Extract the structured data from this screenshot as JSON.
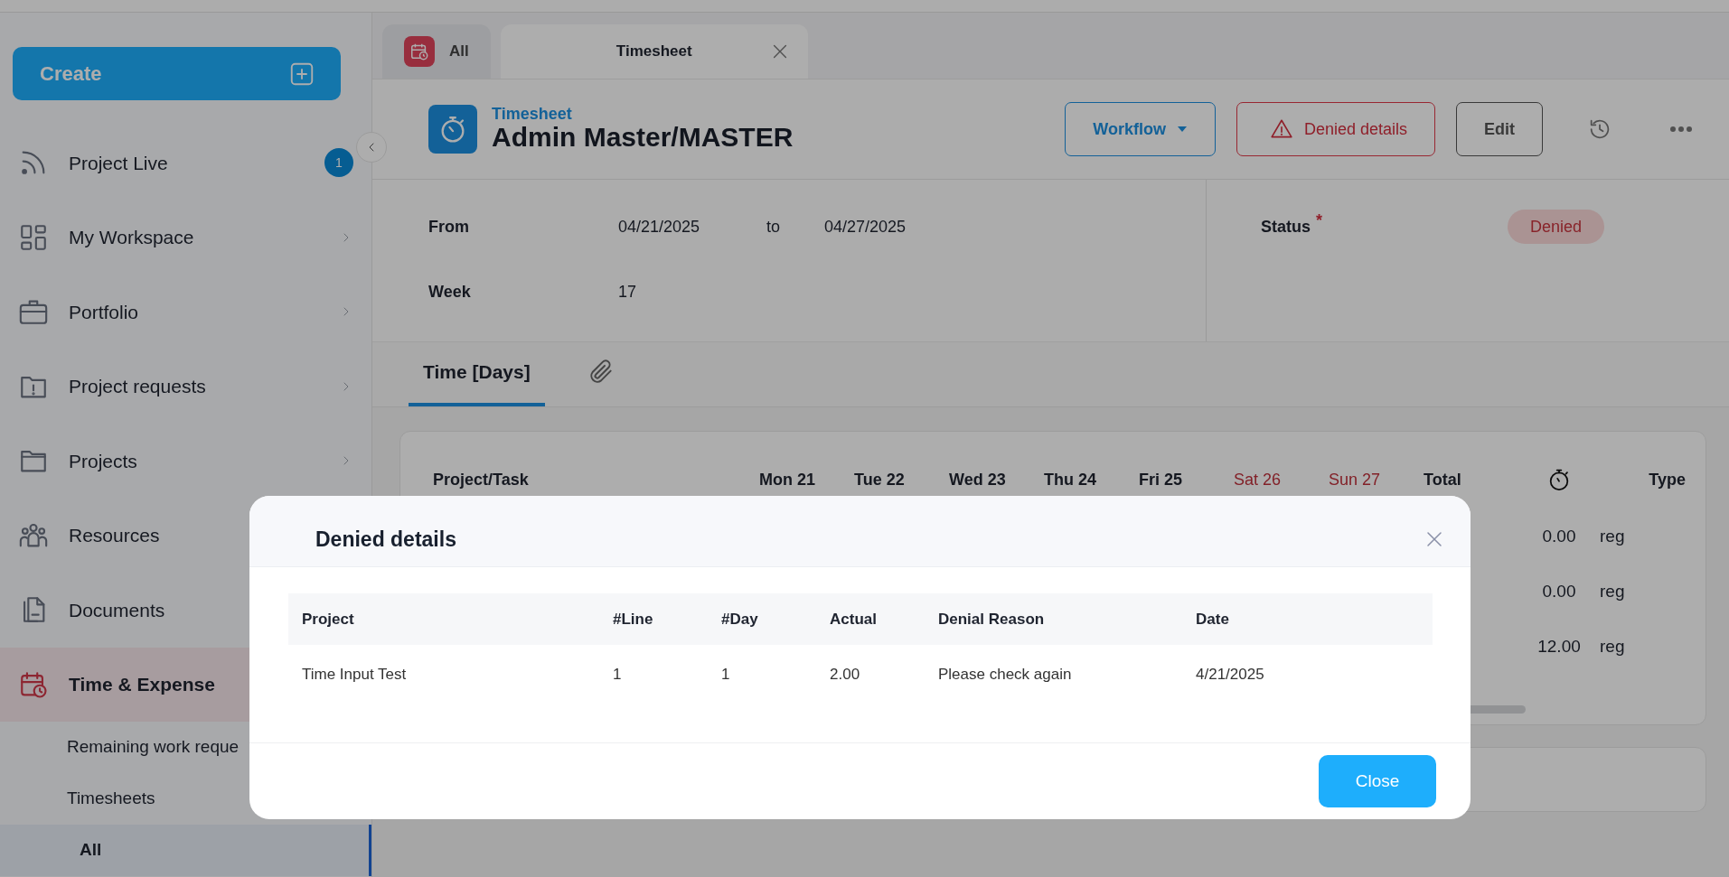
{
  "sidebar": {
    "create_button": {
      "label": "Create"
    },
    "items": [
      {
        "label": "Project Live",
        "badge": "1",
        "selected": false
      },
      {
        "label": "My Workspace",
        "has_submenu": true,
        "selected": false
      },
      {
        "label": "Portfolio",
        "has_submenu": true,
        "selected": false
      },
      {
        "label": "Project requests",
        "has_submenu": true,
        "selected": false
      },
      {
        "label": "Projects",
        "has_submenu": true,
        "selected": false
      },
      {
        "label": "Resources",
        "selected": false
      },
      {
        "label": "Documents",
        "selected": false
      },
      {
        "label": "Time & Expense",
        "selected": true,
        "children": [
          {
            "label": "Remaining work reque",
            "selected": false
          },
          {
            "label": "Timesheets",
            "selected": false,
            "children": [
              {
                "label": "All",
                "selected": true
              }
            ]
          }
        ]
      }
    ]
  },
  "tabs": [
    {
      "label": "All",
      "has_icon": true,
      "closable": false,
      "selected": false
    },
    {
      "label": "Timesheet",
      "has_icon": false,
      "closable": true,
      "selected": true
    }
  ],
  "header": {
    "subtitle": "Timesheet",
    "title": "Admin Master/MASTER",
    "buttons": [
      {
        "kind": "dropdown",
        "label": "Workflow"
      },
      {
        "kind": "danger",
        "label": "Denied details"
      },
      {
        "kind": "plain",
        "label": "Edit"
      }
    ]
  },
  "form": {
    "from_label": "From",
    "from": "04/21/2025",
    "to_label": "to",
    "to": "04/27/2025",
    "week_label": "Week",
    "week": "17",
    "status_label": "Status",
    "status_required_mark": "*",
    "status": "Denied"
  },
  "section_tabs": [
    {
      "kind": "text",
      "label": "Time [Days]",
      "selected": true
    },
    {
      "kind": "attachment",
      "selected": false
    }
  ],
  "timesheet_table": {
    "columns": [
      {
        "kind": "text",
        "label": "Project/Task",
        "weekend": false
      },
      {
        "kind": "text",
        "label": "Mon 21",
        "weekend": false
      },
      {
        "kind": "text",
        "label": "Tue 22",
        "weekend": false
      },
      {
        "kind": "text",
        "label": "Wed 23",
        "weekend": false
      },
      {
        "kind": "text",
        "label": "Thu 24",
        "weekend": false
      },
      {
        "kind": "text",
        "label": "Fri 25",
        "weekend": false
      },
      {
        "kind": "text",
        "label": "Sat 26",
        "weekend": true
      },
      {
        "kind": "text",
        "label": "Sun 27",
        "weekend": true
      },
      {
        "kind": "text",
        "label": "Total",
        "weekend": false
      },
      {
        "kind": "stopwatch"
      },
      {
        "kind": "text",
        "label": "Type",
        "weekend": false
      }
    ],
    "rows": [
      {
        "column_10": "0.00",
        "type": "reg"
      },
      {
        "column_10": "0.00",
        "type": "reg"
      },
      {
        "column_10": "12.00",
        "type": "reg"
      }
    ]
  },
  "modal": {
    "title": "Denied details",
    "columns": [
      "Project",
      "#Line",
      "#Day",
      "Actual",
      "Denial Reason",
      "Date"
    ],
    "rows": [
      [
        "Time Input Test",
        "1",
        "1",
        "2.00",
        "Please check again",
        "4/21/2025"
      ]
    ],
    "close_button": "Close"
  }
}
